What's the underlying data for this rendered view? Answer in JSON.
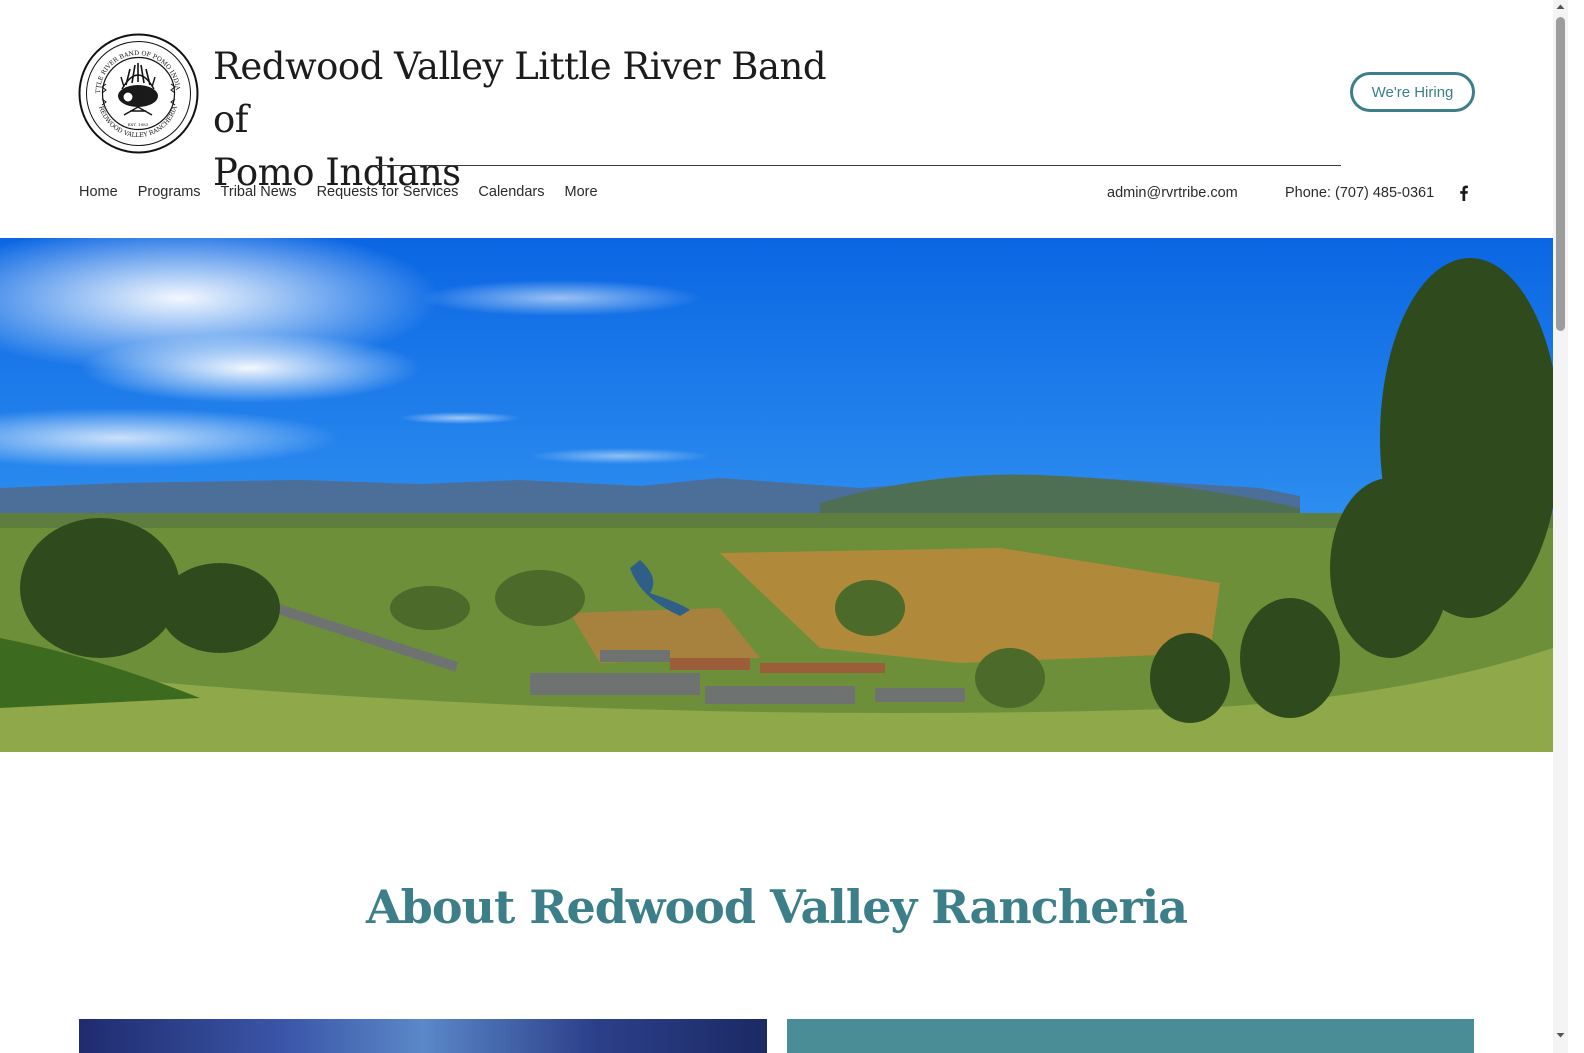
{
  "header": {
    "logo_text_top": "LITTLE RIVER BAND OF POMO INDIANS",
    "logo_text_bottom": "REDWOOD VALLEY RANCHERIA",
    "logo_est": "EST. 1983",
    "title_line1": "Redwood Valley Little River Band of",
    "title_line2": "Pomo Indians",
    "hiring_label": "We're Hiring"
  },
  "nav": {
    "items": [
      {
        "label": "Home"
      },
      {
        "label": "Programs"
      },
      {
        "label": "Tribal News"
      },
      {
        "label": "Requests for Services"
      },
      {
        "label": "Calendars"
      },
      {
        "label": "More"
      }
    ]
  },
  "contact": {
    "email": "admin@rvrtribe.com",
    "phone": "Phone: (707) 485-0361",
    "social_icon": "facebook-icon"
  },
  "about": {
    "title": "About Redwood Valley Rancheria"
  },
  "colors": {
    "accent": "#3d7f89",
    "card_teal": "#4a8d97"
  }
}
